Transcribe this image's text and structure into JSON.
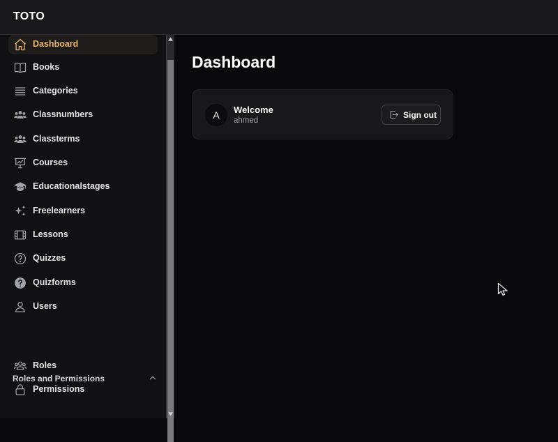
{
  "app": {
    "brand": "TOTO"
  },
  "sidebar": {
    "items": [
      {
        "label": "Dashboard",
        "icon": "home-icon",
        "active": true
      },
      {
        "label": "Books",
        "icon": "book-open-icon"
      },
      {
        "label": "Categories",
        "icon": "list-icon"
      },
      {
        "label": "Classnumbers",
        "icon": "user-group-icon"
      },
      {
        "label": "Classterms",
        "icon": "user-group-icon"
      },
      {
        "label": "Courses",
        "icon": "presentation-chart-icon"
      },
      {
        "label": "Educationalstages",
        "icon": "academic-cap-icon"
      },
      {
        "label": "Freelearners",
        "icon": "sparkles-icon"
      },
      {
        "label": "Lessons",
        "icon": "film-icon"
      },
      {
        "label": "Quizzes",
        "icon": "question-circle-icon"
      },
      {
        "label": "Quizforms",
        "icon": "question-circle-solid-icon"
      },
      {
        "label": "Users",
        "icon": "user-icon"
      }
    ],
    "group": {
      "label": "Roles and Permissions",
      "expanded": true,
      "items": [
        {
          "label": "Roles",
          "icon": "users-icon"
        },
        {
          "label": "Permissions",
          "icon": "lock-icon"
        }
      ]
    }
  },
  "main": {
    "title": "Dashboard",
    "welcome_card": {
      "avatar_initial": "A",
      "heading": "Welcome",
      "username": "ahmed",
      "signout_label": "Sign out"
    }
  },
  "colors": {
    "accent": "#e8b56b",
    "background": "#09090b",
    "sidebar_bg": "#111113",
    "card_bg": "#18181b"
  }
}
